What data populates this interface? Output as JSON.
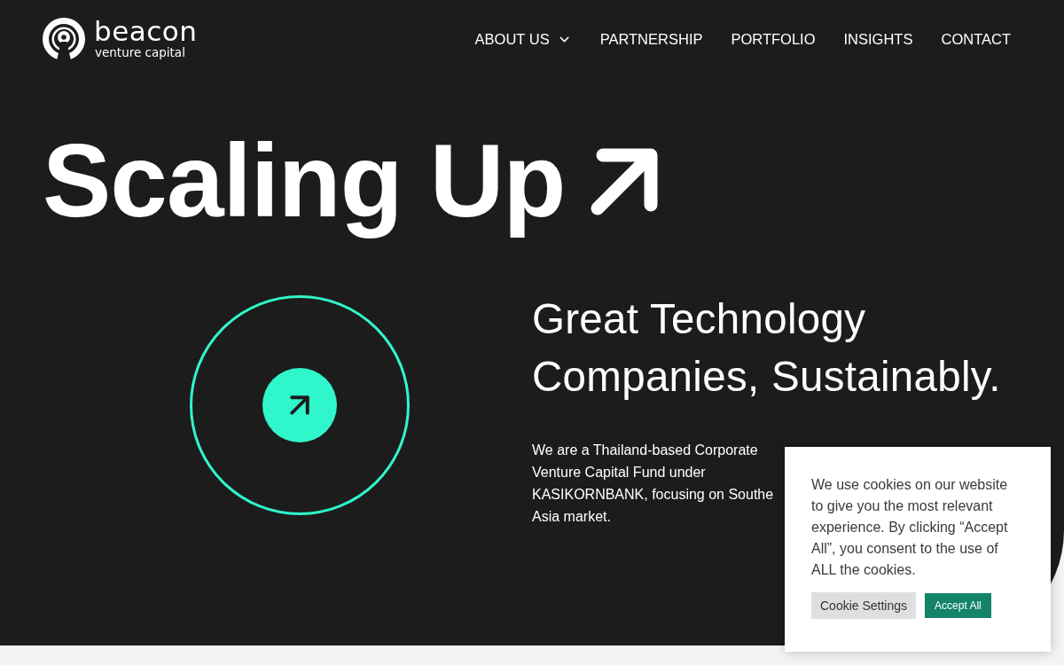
{
  "header": {
    "logo": {
      "name": "beacon",
      "tagline": "venture capital"
    },
    "nav": [
      {
        "label": "ABOUT US",
        "dropdown": true
      },
      {
        "label": "PARTNERSHIP",
        "dropdown": false
      },
      {
        "label": "PORTFOLIO",
        "dropdown": false
      },
      {
        "label": "INSIGHTS",
        "dropdown": false
      },
      {
        "label": "CONTACT",
        "dropdown": false
      }
    ]
  },
  "hero": {
    "headline": "Scaling Up",
    "tagline": "Great Technology Companies, Sustainably.",
    "body_lines": [
      "We are a Thailand-based Corporate",
      "Venture Capital Fund under",
      "KASIKORNBANK, focusing on Southe",
      "Asia market."
    ]
  },
  "cookie_banner": {
    "text": "We use cookies on our website to give you the most relevant experience. By clicking “Accept All”, you consent to the use of ALL the cookies.",
    "buttons": [
      {
        "label": "Cookie Settings",
        "kind": "secondary"
      },
      {
        "label": "Accept All",
        "kind": "primary"
      }
    ]
  }
}
